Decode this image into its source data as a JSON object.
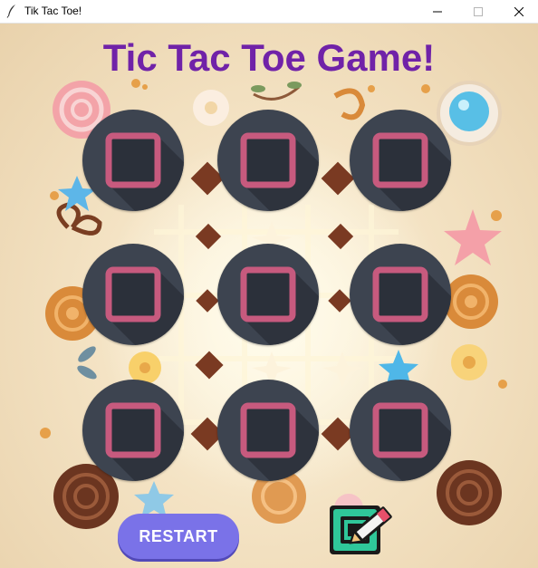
{
  "window": {
    "title": "Tik Tac Toe!",
    "app_icon": "feather-icon",
    "controls": [
      "minimize-icon",
      "maximize-icon",
      "close-icon"
    ]
  },
  "game": {
    "title": "Tic Tac Toe Game!",
    "title_color": "#7022a8",
    "cell_color": "#3d4450",
    "mark_color": "#c75a7e",
    "board": [
      [
        "square",
        "square",
        "square"
      ],
      [
        "square",
        "square",
        "square"
      ],
      [
        "square",
        "square",
        "square"
      ]
    ]
  },
  "controls": {
    "restart_label": "RESTART",
    "restart_color": "#7a72e8",
    "edit_icon": "pencil-edit-icon"
  }
}
